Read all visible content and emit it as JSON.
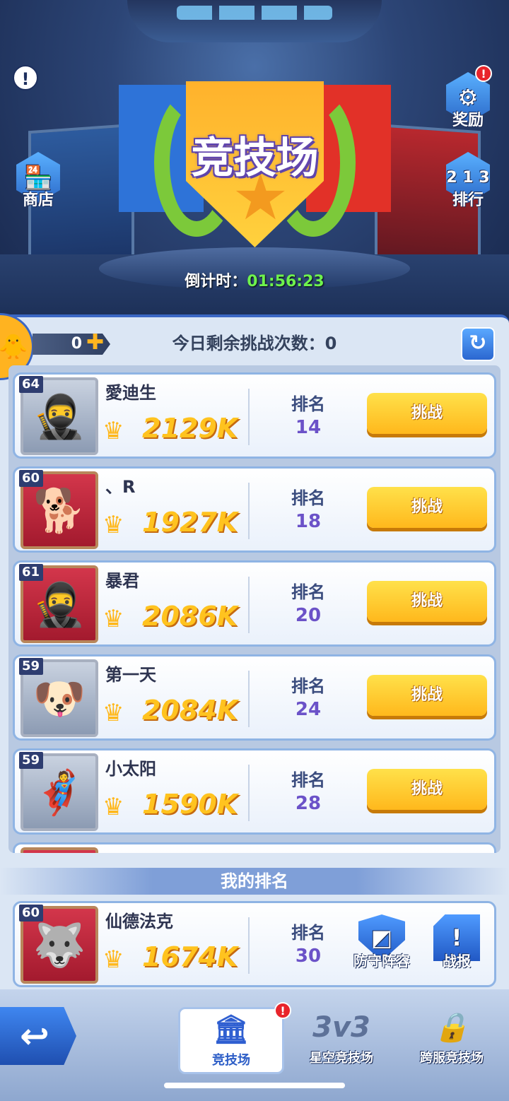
{
  "header": {
    "title": "竞技场",
    "countdown_label": "倒计时：",
    "countdown_value": "01:56:23",
    "alert_icon": "!",
    "shop_label": "商店",
    "reward_label": "奖励",
    "reward_badge": "!",
    "ranking_label": "排行"
  },
  "panel": {
    "coins": "0",
    "remaining_text": "今日剩余挑战次数：0"
  },
  "opponents": [
    {
      "level": "64",
      "name": "愛迪生",
      "power": "2129K",
      "rank_label": "排名",
      "rank": "14",
      "button": "挑战"
    },
    {
      "level": "60",
      "name": "、R",
      "power": "1927K",
      "rank_label": "排名",
      "rank": "18",
      "button": "挑战"
    },
    {
      "level": "61",
      "name": "暴君",
      "power": "2086K",
      "rank_label": "排名",
      "rank": "20",
      "button": "挑战"
    },
    {
      "level": "59",
      "name": "第一天",
      "power": "2084K",
      "rank_label": "排名",
      "rank": "24",
      "button": "挑战"
    },
    {
      "level": "59",
      "name": "小太阳",
      "power": "1590K",
      "rank_label": "排名",
      "rank": "28",
      "button": "挑战"
    }
  ],
  "my_rank": {
    "title": "我的排名",
    "level": "60",
    "name": "仙德法克",
    "power": "1674K",
    "rank_label": "排名",
    "rank": "30",
    "defense_label": "防守阵容",
    "report_label": "战报"
  },
  "tabs": [
    {
      "label": "竞技场",
      "badge": "!"
    },
    {
      "label": "星空竞技场",
      "icon_text": "3v3"
    },
    {
      "label": "跨服竞技场"
    }
  ]
}
